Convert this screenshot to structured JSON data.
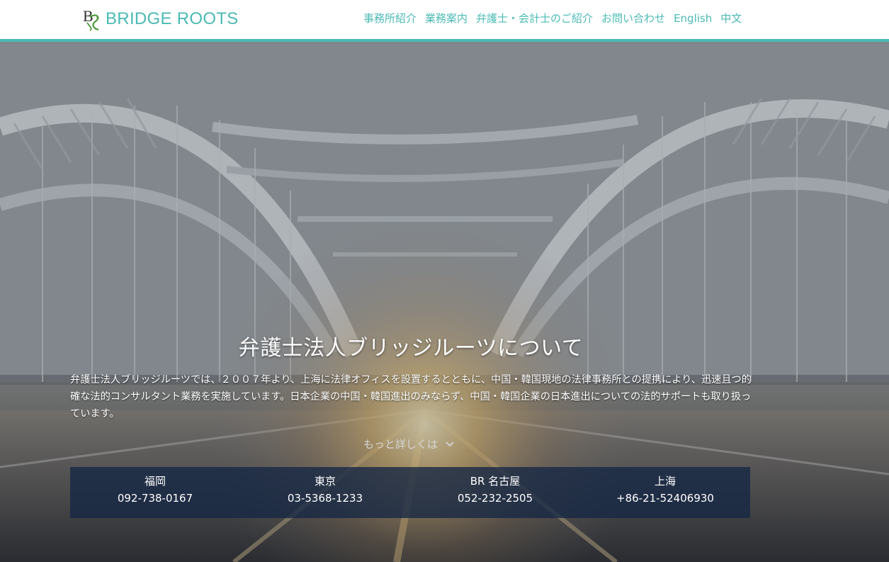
{
  "header": {
    "logo_text": "BRIDGE ROOTS",
    "nav": [
      {
        "label": "事務所紹介"
      },
      {
        "label": "業務案内"
      },
      {
        "label": "弁護士・会計士のご紹介"
      },
      {
        "label": "お問い合わせ"
      },
      {
        "label": "English"
      },
      {
        "label": "中文"
      }
    ]
  },
  "hero": {
    "title": "弁護士法人ブリッジルーツについて",
    "description": "弁護士法人ブリッジルーツでは、２００７年より、上海に法律オフィスを設置するとともに、中国・韓国現地の法律事務所との提携により、迅速且つ的確な法的コンサルタント業務を実施しています。日本企業の中国・韓国進出のみならず、中国・韓国企業の日本進出についての法的サポートも取り扱っています。",
    "more_label": "もっと詳しくは"
  },
  "offices": [
    {
      "name": "福岡",
      "phone": "092-738-0167"
    },
    {
      "name": "東京",
      "phone": "03-5368-1233"
    },
    {
      "name": "BR 名古屋",
      "phone": "052-232-2505"
    },
    {
      "name": "上海",
      "phone": "+86-21-52406930"
    }
  ],
  "colors": {
    "accent": "#4bbab5",
    "office_bar": "#14264480"
  },
  "icons": {
    "logo": "bridge-roots-logo-icon",
    "more": "chevron-down-icon"
  }
}
